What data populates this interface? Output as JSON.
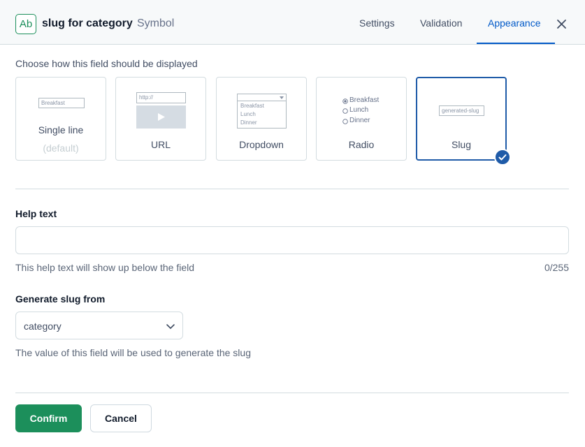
{
  "header": {
    "field_icon_text": "Ab",
    "field_name": "slug for category",
    "field_type": "Symbol",
    "tabs": [
      {
        "label": "Settings"
      },
      {
        "label": "Validation"
      },
      {
        "label": "Appearance",
        "active": true
      }
    ],
    "close_icon": "close-icon"
  },
  "appearance": {
    "section_label": "Choose how this field should be displayed",
    "options": [
      {
        "title": "Single line",
        "subtitle": "(default)",
        "preview": [
          "Breakfast"
        ]
      },
      {
        "title": "URL",
        "preview": [
          "http://"
        ]
      },
      {
        "title": "Dropdown",
        "preview": [
          "Breakfast",
          "Lunch",
          "Dinner"
        ]
      },
      {
        "title": "Radio",
        "preview": [
          "Breakfast",
          "Lunch",
          "Dinner"
        ]
      },
      {
        "title": "Slug",
        "preview": [
          "generated-slug"
        ],
        "selected": true
      }
    ],
    "selected_icon": "check-circle-icon",
    "accent_color": "#1f5ba8"
  },
  "help_text": {
    "label": "Help text",
    "value": "",
    "hint": "This help text will show up below the field",
    "counter": "0/255"
  },
  "slug_source": {
    "label": "Generate slug from",
    "selected": "category",
    "hint": "The value of this field will be used to generate the slug"
  },
  "footer": {
    "confirm_label": "Confirm",
    "cancel_label": "Cancel",
    "confirm_color": "#1c8f5b"
  }
}
